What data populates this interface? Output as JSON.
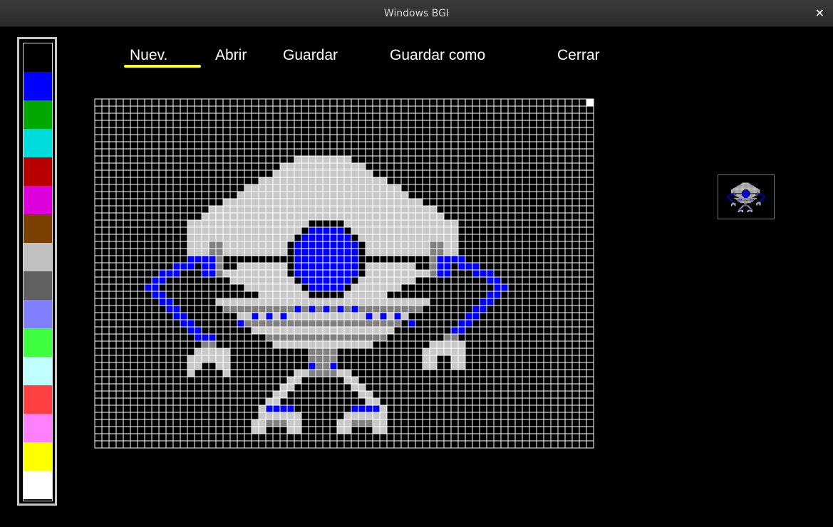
{
  "window": {
    "title": "Windows BGI",
    "close_label": "×"
  },
  "menu": {
    "items": [
      {
        "label": "Nuev.",
        "name": "menu-nuevo"
      },
      {
        "label": "Abrir",
        "name": "menu-abrir"
      },
      {
        "label": "Guardar",
        "name": "menu-guardar"
      },
      {
        "label": "Guardar como",
        "name": "menu-guardar-como"
      },
      {
        "label": "Cerrar",
        "name": "menu-cerrar"
      }
    ],
    "active": "Nuev.",
    "active_underline_color": "#ffff00"
  },
  "palette": {
    "colors": [
      "#000000",
      "#0000ff",
      "#00a800",
      "#00dcdc",
      "#b80000",
      "#dc00dc",
      "#7a4000",
      "#c0c0c0",
      "#606060",
      "#8080ff",
      "#40ff40",
      "#c0ffff",
      "#ff4040",
      "#ff80ff",
      "#ffff00",
      "#ffffff"
    ]
  },
  "grid": {
    "cols": 70,
    "rows": 49,
    "line_color": "#ffffff",
    "background": "#000000"
  },
  "colors": {
    "light_gray": "#c8c8c8",
    "dark_gray": "#808080",
    "blue": "#0000ff",
    "black": "#000000",
    "white": "#ffffff"
  }
}
